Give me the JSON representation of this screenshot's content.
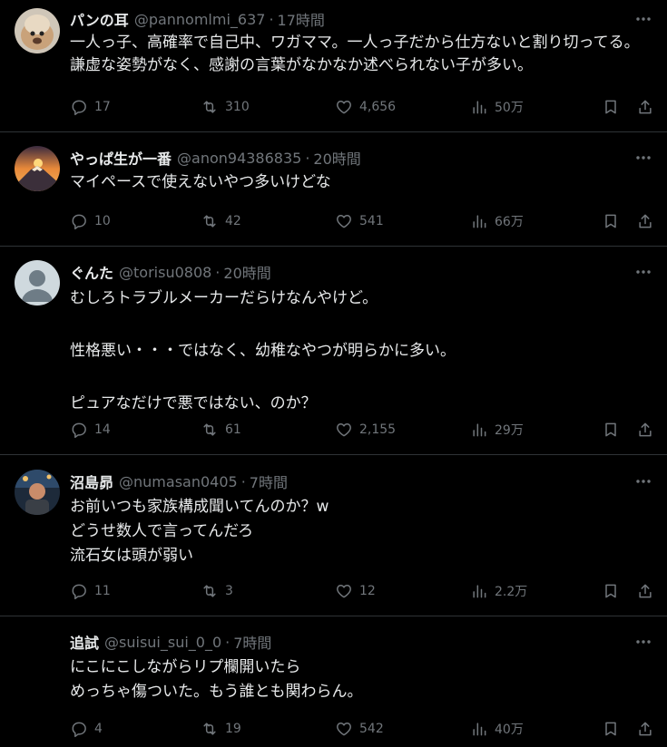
{
  "tweets": [
    {
      "name": "パンの耳",
      "handle": "@pannomlmi_637",
      "time": "17時間",
      "text": "一人っ子、高確率で自己中、ワガママ。一人っ子だから仕方ないと割り切ってる。謙虚な姿勢がなく、感謝の言葉がなかなか述べられない子が多い。",
      "replies": "17",
      "retweets": "310",
      "likes": "4,656",
      "views": "50万",
      "avatar_icon": "toast-dog-avatar"
    },
    {
      "name": "やっぱ生が一番",
      "handle": "@anon94386835",
      "time": "20時間",
      "text": "マイペースで使えないやつ多いけどな",
      "replies": "10",
      "retweets": "42",
      "likes": "541",
      "views": "66万",
      "avatar_icon": "mount-fuji-sunset-avatar"
    },
    {
      "name": "ぐんた",
      "handle": "@torisu0808",
      "time": "20時間",
      "text": "むしろトラブルメーカーだらけなんやけど。\n\n性格悪い・・・ではなく、幼稚なやつが明らかに多い。\n\nピュアなだけで悪ではない、のか？",
      "replies": "14",
      "retweets": "61",
      "likes": "2,155",
      "views": "29万",
      "avatar_icon": "default-user-avatar"
    },
    {
      "name": "沼島昴",
      "handle": "@numasan0405",
      "time": "7時間",
      "text": "お前いつも家族構成聞いてんのか？w\nどうせ数人で言ってんだろ\n流石女は頭が弱い",
      "replies": "11",
      "retweets": "3",
      "likes": "12",
      "views": "2.2万",
      "avatar_icon": "photo-avatar"
    },
    {
      "name": "追試",
      "handle": "@suisui_sui_0_0",
      "time": "7時間",
      "text": "にこにこしながらリプ欄開いたら\nめっちゃ傷ついた。もう誰とも関わらん。",
      "replies": "4",
      "retweets": "19",
      "likes": "542",
      "views": "40万",
      "avatar_icon": ""
    }
  ]
}
